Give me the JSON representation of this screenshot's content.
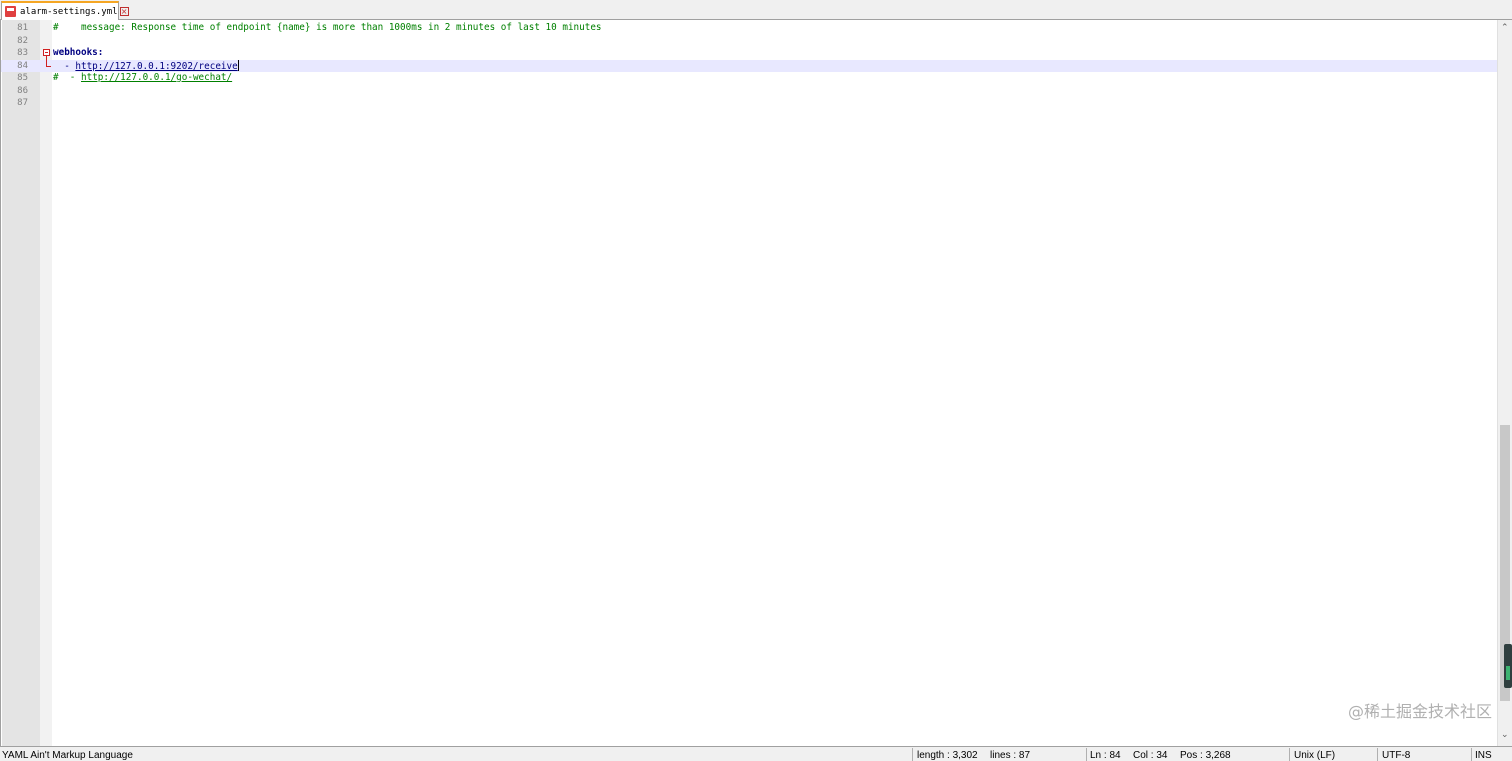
{
  "tab": {
    "label": "alarm-settings.yml",
    "close_glyph": "×"
  },
  "editor": {
    "lines": [
      {
        "num": "81",
        "text": "#    message: Response time of endpoint {name} is more than 1000ms in 2 minutes of last 10 minutes"
      },
      {
        "num": "82",
        "text": ""
      },
      {
        "num": "83",
        "text": "webhooks:"
      },
      {
        "num": "84",
        "prefix": "  - ",
        "url": "http://127.0.0.1:9202/receive"
      },
      {
        "num": "85",
        "prefix": "#  - ",
        "url": "http://127.0.0.1/go-wechat/"
      },
      {
        "num": "86",
        "text": ""
      },
      {
        "num": "87",
        "text": ""
      }
    ]
  },
  "watermark": "@稀土掘金技术社区",
  "statusbar": {
    "language": "YAML Ain't Markup Language",
    "length": "length : 3,302",
    "lines": "lines : 87",
    "ln": "Ln : 84",
    "col": "Col : 34",
    "pos": "Pos : 3,268",
    "eol": "Unix (LF)",
    "encoding": "UTF-8",
    "mode": "INS"
  },
  "colors": {
    "comment": "#008000",
    "keyword": "#000080",
    "current_line": "#e8e8ff",
    "tab_accent": "#f5a623",
    "fold": "#d02020"
  }
}
